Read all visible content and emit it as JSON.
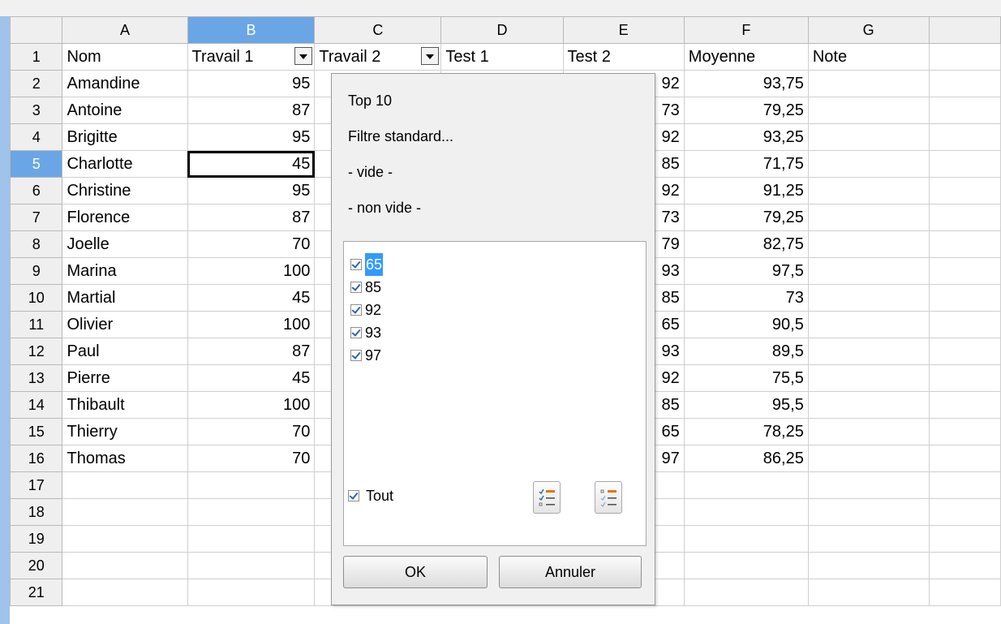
{
  "columns": [
    "A",
    "B",
    "C",
    "D",
    "E",
    "F",
    "G"
  ],
  "headers": {
    "nom": "Nom",
    "travail1": "Travail 1",
    "travail2": "Travail 2",
    "test1": "Test 1",
    "test2": "Test 2",
    "moyenne": "Moyenne",
    "note": "Note"
  },
  "row_numbers": [
    "1",
    "2",
    "3",
    "4",
    "5",
    "6",
    "7",
    "8",
    "9",
    "10",
    "11",
    "12",
    "13",
    "14",
    "15",
    "16",
    "17",
    "18",
    "19",
    "20",
    "21"
  ],
  "rows": [
    {
      "nom": "Amandine",
      "travail1": "95",
      "test2": "92",
      "moyenne": "93,75"
    },
    {
      "nom": "Antoine",
      "travail1": "87",
      "test2": "73",
      "moyenne": "79,25"
    },
    {
      "nom": "Brigitte",
      "travail1": "95",
      "test2": "92",
      "moyenne": "93,25"
    },
    {
      "nom": "Charlotte",
      "travail1": "45",
      "test2": "85",
      "moyenne": "71,75"
    },
    {
      "nom": "Christine",
      "travail1": "95",
      "test2": "92",
      "moyenne": "91,25"
    },
    {
      "nom": "Florence",
      "travail1": "87",
      "test2": "73",
      "moyenne": "79,25"
    },
    {
      "nom": "Joelle",
      "travail1": "70",
      "test2": "79",
      "moyenne": "82,75"
    },
    {
      "nom": "Marina",
      "travail1": "100",
      "test2": "93",
      "moyenne": "97,5"
    },
    {
      "nom": "Martial",
      "travail1": "45",
      "test2": "85",
      "moyenne": "73"
    },
    {
      "nom": "Olivier",
      "travail1": "100",
      "test2": "65",
      "moyenne": "90,5"
    },
    {
      "nom": "Paul",
      "travail1": "87",
      "test2": "93",
      "moyenne": "89,5"
    },
    {
      "nom": "Pierre",
      "travail1": "45",
      "test2": "92",
      "moyenne": "75,5"
    },
    {
      "nom": "Thibault",
      "travail1": "100",
      "test2": "85",
      "moyenne": "95,5"
    },
    {
      "nom": "Thierry",
      "travail1": "70",
      "test2": "65",
      "moyenne": "78,25"
    },
    {
      "nom": "Thomas",
      "travail1": "70",
      "test2": "97",
      "moyenne": "86,25"
    }
  ],
  "active_column": "B",
  "active_row": "5",
  "filter_popup": {
    "menu": [
      "Top 10",
      "Filtre standard...",
      "- vide -",
      "- non vide -"
    ],
    "values": [
      {
        "label": "65",
        "checked": true,
        "selected": true
      },
      {
        "label": "85",
        "checked": true,
        "selected": false
      },
      {
        "label": "92",
        "checked": true,
        "selected": false
      },
      {
        "label": "93",
        "checked": true,
        "selected": false
      },
      {
        "label": "97",
        "checked": true,
        "selected": false
      }
    ],
    "all_label": "Tout",
    "all_checked": true,
    "ok_label": "OK",
    "cancel_label": "Annuler",
    "icons": [
      "check-all-icon",
      "uncheck-all-icon"
    ]
  },
  "colors": {
    "selection": "#6aa6e6",
    "highlight": "#3399ff",
    "checkmark": "#2e63b5",
    "accent": "#e8740c"
  }
}
